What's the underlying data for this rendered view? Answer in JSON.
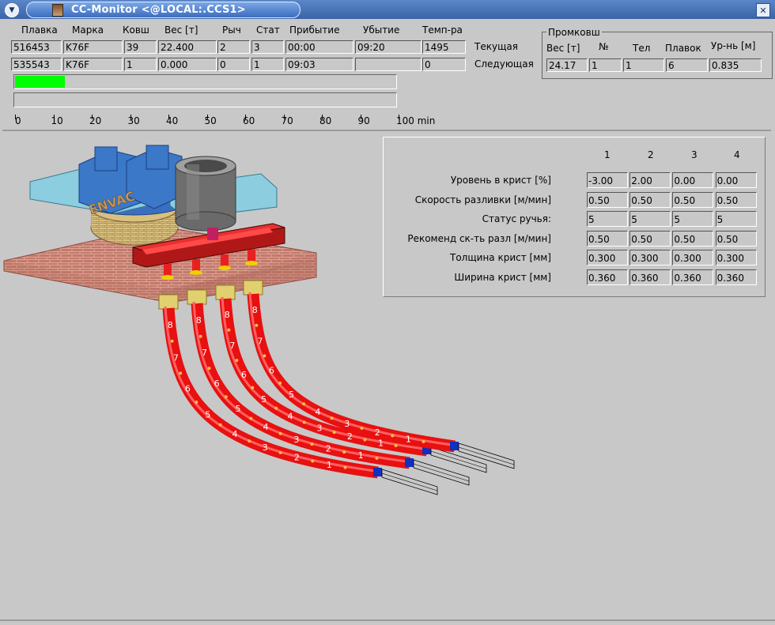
{
  "window": {
    "title": "CC-Monitor <@LOCAL:.CCS1>"
  },
  "heats": {
    "headers": [
      "Плавка",
      "Марка",
      "Ковш",
      "Вес [т]",
      "Рыч",
      "Стат",
      "Прибытие",
      "Убытие",
      "Темп-ра"
    ],
    "rows": [
      {
        "label": "Текущая",
        "values": [
          "516453",
          "K76F",
          "39",
          "22.400",
          "2",
          "3",
          "00:00",
          "09:20",
          "1495"
        ]
      },
      {
        "label": "Следующая",
        "values": [
          "535543",
          "K76F",
          "1",
          "0.000",
          "0",
          "1",
          "09:03",
          "",
          "0"
        ]
      }
    ]
  },
  "tundish": {
    "title": "Промковш",
    "headers": [
      "Вес [т]",
      "№",
      "Тел",
      "Плавок",
      "Ур-нь [м]"
    ],
    "values": [
      "24.17",
      "1",
      "1",
      "6",
      "0.835"
    ]
  },
  "timeline": {
    "progress_fraction": 0.13,
    "second_bar_fraction": 0.0,
    "ticks": [
      "0",
      "10",
      "20",
      "30",
      "40",
      "50",
      "60",
      "70",
      "80",
      "90",
      "100 min"
    ]
  },
  "strands": {
    "columns": [
      "1",
      "2",
      "3",
      "4"
    ],
    "rows": [
      {
        "label": "Уровень в крист [%]",
        "values": [
          "-3.00",
          "2.00",
          "0.00",
          "0.00"
        ]
      },
      {
        "label": "Скорость разливки [м/мин]",
        "values": [
          "0.50",
          "0.50",
          "0.50",
          "0.50"
        ]
      },
      {
        "label": "Статус ручья:",
        "values": [
          "5",
          "5",
          "5",
          "5"
        ]
      },
      {
        "label": "Рекоменд ск-ть разл [м/мин]",
        "values": [
          "0.50",
          "0.50",
          "0.50",
          "0.50"
        ]
      },
      {
        "label": "Толщина крист [мм]",
        "values": [
          "0.300",
          "0.300",
          "0.300",
          "0.300"
        ]
      },
      {
        "label": "Ширина крист [мм]",
        "values": [
          "0.360",
          "0.360",
          "0.360",
          "0.360"
        ]
      }
    ]
  },
  "scene": {
    "turret_logo": "ENVAC",
    "segment_labels": [
      "8",
      "7",
      "6",
      "5",
      "4",
      "3",
      "2",
      "1"
    ],
    "colors": {
      "strand": "#e81010",
      "segment_outline": "#f0c040",
      "tip": "#1030c0",
      "brick": "#c07868",
      "tundish": "#b01818",
      "turret": "#3a78c8",
      "support": "#8ccde0",
      "ladle": "#808080"
    }
  }
}
